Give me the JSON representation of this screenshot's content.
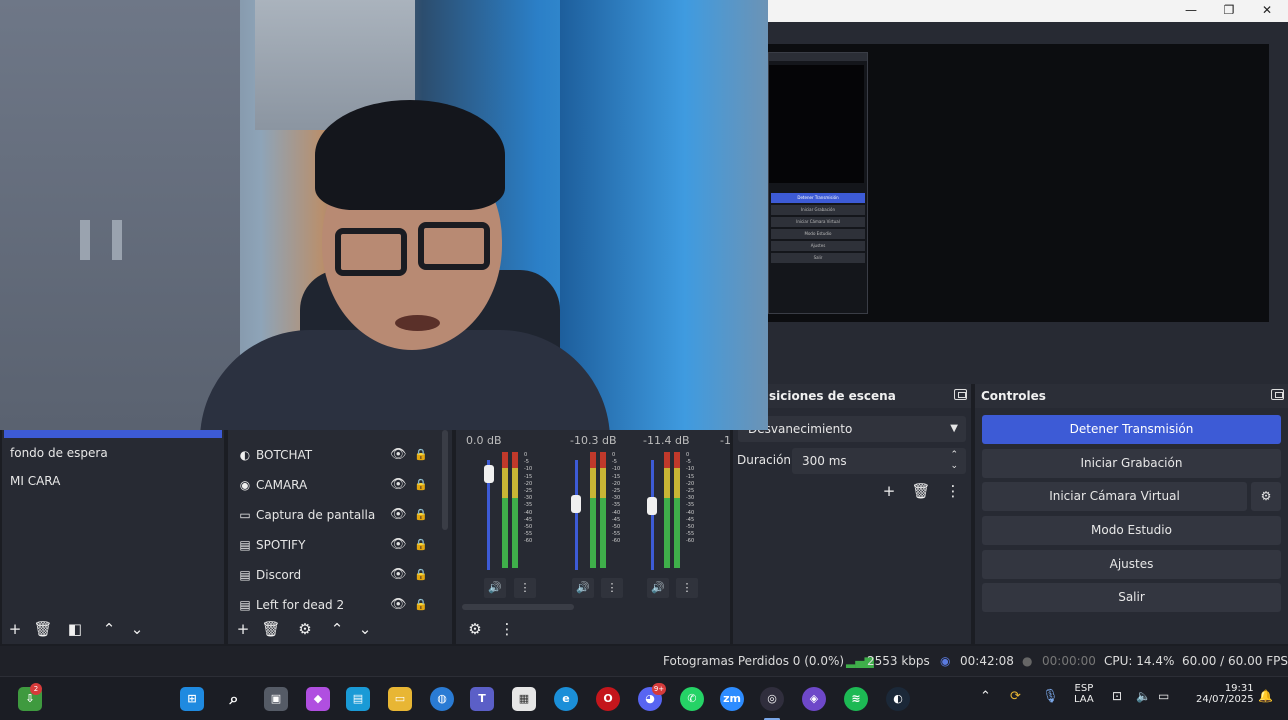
{
  "window": {
    "minimize": "—",
    "maximize": "❐",
    "close": "✕"
  },
  "nested_preview": {
    "buttons": [
      "Detener Transmisión",
      "Iniciar Grabación",
      "Iniciar Cámara Virtual",
      "Modo Estudio",
      "Ajustes",
      "Salir"
    ]
  },
  "scenes": {
    "items": [
      "fondo de espera",
      "MI CARA"
    ]
  },
  "sources": {
    "items": [
      {
        "label": "BOTCHAT",
        "icon": "browser-icon"
      },
      {
        "label": "CAMARA",
        "icon": "camera-icon"
      },
      {
        "label": "Captura de pantalla",
        "icon": "monitor-icon"
      },
      {
        "label": "SPOTIFY",
        "icon": "window-capture-icon"
      },
      {
        "label": "Discord",
        "icon": "window-capture-icon"
      },
      {
        "label": "Left for dead 2",
        "icon": "window-capture-icon"
      }
    ]
  },
  "mixer": {
    "channels": [
      {
        "db": "0.0 dB",
        "level": 0.95
      },
      {
        "db": "-10.3 dB",
        "level": 0.62
      },
      {
        "db": "-11.4 dB",
        "level": 0.6
      }
    ],
    "partial_db": "-1",
    "scale": [
      "0",
      "-5",
      "-10",
      "-15",
      "-20",
      "-25",
      "-30",
      "-35",
      "-40",
      "-45",
      "-50",
      "-55",
      "-60"
    ]
  },
  "transitions": {
    "title": "siciones de escena",
    "type": "Desvanecimiento",
    "duration_label": "Duración",
    "duration_value": "300 ms"
  },
  "controls": {
    "title": "Controles",
    "stop_stream": "Detener Transmisión",
    "start_recording": "Iniciar Grabación",
    "start_virtual_cam": "Iniciar Cámara Virtual",
    "studio_mode": "Modo Estudio",
    "settings": "Ajustes",
    "exit": "Salir"
  },
  "status": {
    "dropped_frames": "Fotogramas Perdidos 0 (0.0%)",
    "bitrate": "2553 kbps",
    "stream_time": "00:42:08",
    "rec_time": "00:00:00",
    "cpu": "CPU: 14.4%",
    "fps": "60.00 / 60.00 FPS"
  },
  "taskbar": {
    "lang_top": "ESP",
    "lang_bottom": "LAA",
    "time": "19:31",
    "date": "24/07/2025",
    "badge_store": "2",
    "badge_discord": "9+",
    "zoom_label": "zm"
  },
  "colors": {
    "accent": "#3d5bd6",
    "panel": "#272a33",
    "green_meter": "#3fae4a"
  }
}
